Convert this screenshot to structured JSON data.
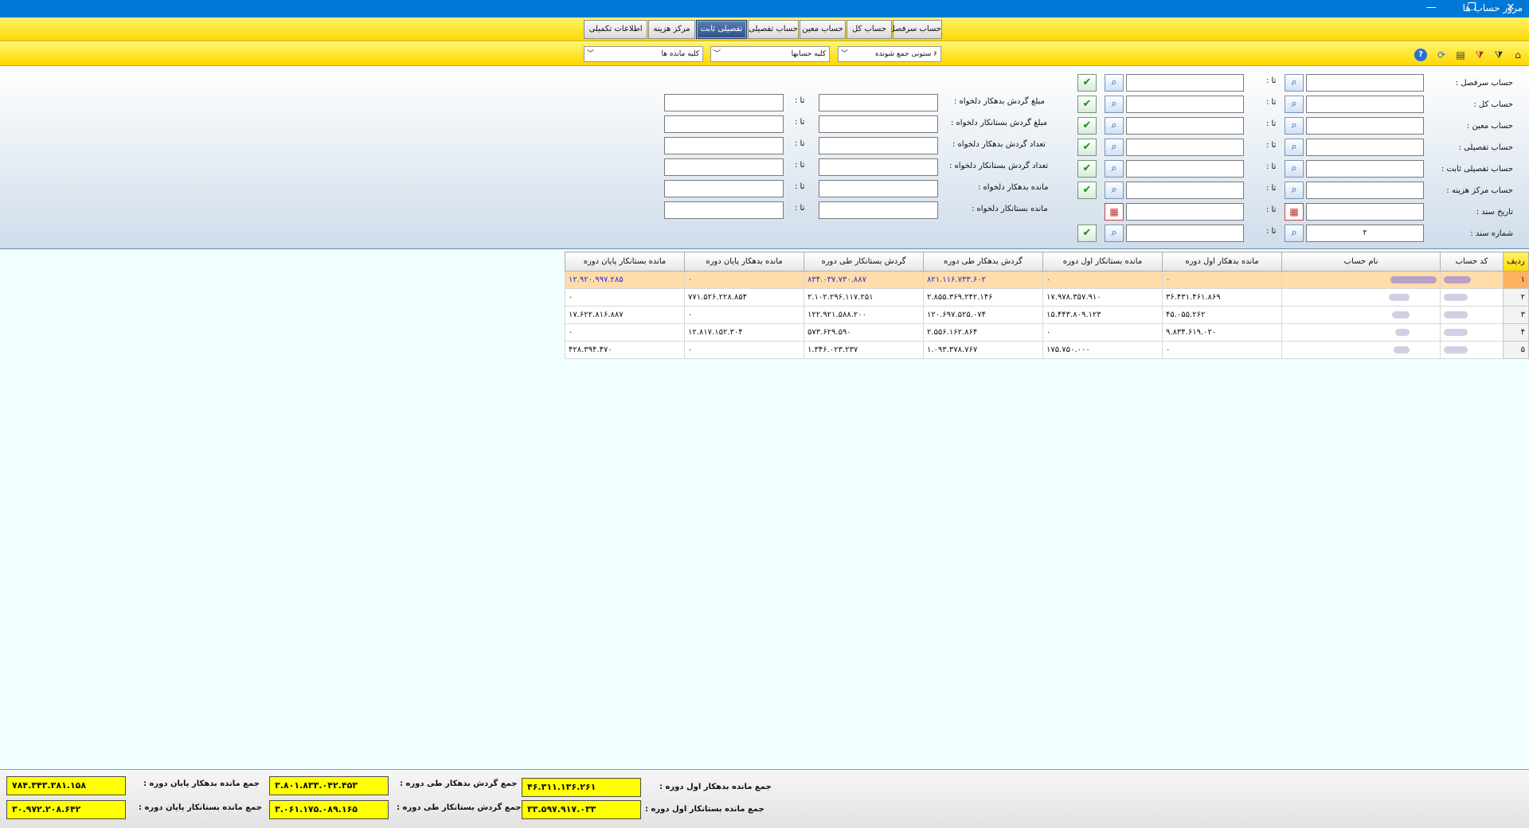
{
  "window": {
    "title": "مرور حساب ها",
    "minimize": "—",
    "restore": "❐",
    "close": "✕"
  },
  "tabs": [
    {
      "label": "حساب سرفصل"
    },
    {
      "label": "حساب کل"
    },
    {
      "label": "حساب معین"
    },
    {
      "label": "حساب تفصیلی"
    },
    {
      "label": "تفصیلی ثابت",
      "active": true
    },
    {
      "label": "مرکز هزینه"
    },
    {
      "label": "اطلاعات تکمیلی"
    }
  ],
  "toolbar": {
    "dropdown_columns": "۶ ستونی جمع شونده",
    "dropdown_accounts": "کلیه حسابها",
    "dropdown_balances": "کلیه مانده ها",
    "icons": [
      "home-icon",
      "filter-icon",
      "clear-filter-icon",
      "export-icon",
      "refresh-icon",
      "help-icon"
    ]
  },
  "filters": {
    "to_label": "تا :",
    "left": [
      {
        "label": "حساب سرفصل :",
        "from": "",
        "to": "",
        "kind": "search"
      },
      {
        "label": "حساب کل :",
        "from": "",
        "to": "",
        "kind": "search"
      },
      {
        "label": "حساب معین :",
        "from": "",
        "to": "",
        "kind": "search"
      },
      {
        "label": "حساب تفصیلی :",
        "from": "",
        "to": "",
        "kind": "search"
      },
      {
        "label": "حساب تفصیلی ثابت :",
        "from": "",
        "to": "",
        "kind": "search"
      },
      {
        "label": "حساب مرکز هزینه :",
        "from": "",
        "to": "",
        "kind": "search"
      },
      {
        "label": "تاریخ سند :",
        "from": "",
        "to": "",
        "kind": "calendar"
      },
      {
        "label": "شماره سند :",
        "from": "۲",
        "to": "",
        "kind": "search"
      }
    ],
    "right": [
      {
        "label": "مبلغ گردش بدهکار دلخواه :",
        "from": "",
        "to": ""
      },
      {
        "label": "مبلغ گردش بستانکار دلخواه :",
        "from": "",
        "to": ""
      },
      {
        "label": "تعداد گردش بدهکار دلخواه :",
        "from": "",
        "to": ""
      },
      {
        "label": "تعداد گردش بستانکار دلخواه :",
        "from": "",
        "to": ""
      },
      {
        "label": "مانده بدهکار دلخواه :",
        "from": "",
        "to": ""
      },
      {
        "label": "مانده بستانکار دلخواه :",
        "from": "",
        "to": ""
      }
    ]
  },
  "grid": {
    "columns": [
      "ردیف",
      "کد حساب",
      "نام حساب",
      "مانده بدهکار اول دوره",
      "مانده بستانکار اول دوره",
      "گردش بدهکار طی دوره",
      "گردش بستانکار طی دوره",
      "مانده بدهکار پایان دوره",
      "مانده بستانکار پایان دوره"
    ],
    "rows": [
      {
        "n": "۱",
        "selected": true,
        "v": [
          "۰",
          "۰",
          "۸۲۱.۱۱۶.۷۳۳.۶۰۲",
          "۸۳۴.۰۳۷.۷۳۰.۸۸۷",
          "۰",
          "۱۲.۹۲۰.۹۹۷.۲۸۵"
        ]
      },
      {
        "n": "۲",
        "v": [
          "۳۶.۴۳۱.۴۶۱.۸۶۹",
          "۱۷.۹۷۸.۳۵۷.۹۱۰",
          "۲.۸۵۵.۳۶۹.۲۴۲.۱۴۶",
          "۲.۱۰۲.۲۹۶.۱۱۷.۲۵۱",
          "۷۷۱.۵۲۶.۲۲۸.۸۵۴",
          "۰"
        ]
      },
      {
        "n": "۳",
        "v": [
          "۴۵.۰۵۵.۲۶۲",
          "۱۵.۴۴۳.۸۰۹.۱۲۳",
          "۱۲۰.۶۹۷.۵۲۵.۰۷۴",
          "۱۲۲.۹۲۱.۵۸۸.۲۰۰",
          "۰",
          "۱۷.۶۲۲.۸۱۶.۸۸۷"
        ]
      },
      {
        "n": "۴",
        "v": [
          "۹.۸۳۴.۶۱۹.۰۲۰",
          "۰",
          "۲.۵۵۶.۱۶۲.۸۶۴",
          "۵۷۳.۶۲۹.۵۹۰",
          "۱۲.۸۱۷.۱۵۲.۳۰۴",
          "۰"
        ]
      },
      {
        "n": "۵",
        "v": [
          "۰",
          "۱۷۵.۷۵۰.۰۰۰",
          "۱.۰۹۳.۳۷۸.۷۶۷",
          "۱.۳۴۶.۰۲۳.۲۳۷",
          "۰",
          "۴۲۸.۳۹۴.۴۷۰"
        ]
      }
    ]
  },
  "totals": {
    "deb_begin_label": "جمع مانده بدهکار اول دوره :",
    "deb_begin": "۴۶.۳۱۱.۱۳۶.۲۶۱",
    "cred_begin_label": "جمع مانده بستانکار اول دوره :",
    "cred_begin": "۳۳.۵۹۷.۹۱۷.۰۳۳",
    "deb_turn_label": "جمع گردش بدهکار طی دوره :",
    "deb_turn": "۳.۸۰۱.۸۳۳.۰۴۲.۴۵۳",
    "cred_turn_label": "جمع گردش بستانکار طی دوره :",
    "cred_turn": "۳.۰۶۱.۱۷۵.۰۸۹.۱۶۵",
    "deb_end_label": "جمع مانده بدهکار پایان دوره :",
    "deb_end": "۷۸۴.۳۴۳.۳۸۱.۱۵۸",
    "cred_end_label": "جمع مانده بستانکار پایان دوره :",
    "cred_end": "۳۰.۹۷۲.۲۰۸.۶۴۲"
  }
}
